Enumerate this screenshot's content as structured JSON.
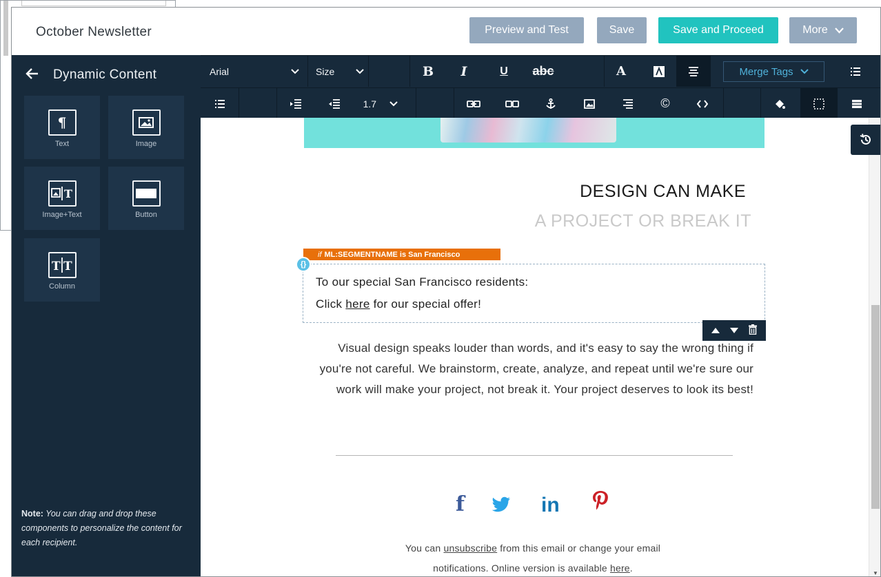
{
  "topbar": {
    "title": "October Newsletter",
    "preview_label": "Preview and Test",
    "save_label": "Save",
    "proceed_label": "Save and Proceed",
    "more_label": "More",
    "accent_color": "#21c3bf",
    "button_color": "#94a8bd"
  },
  "sidebar": {
    "title": "Dynamic Content",
    "back_icon": "arrow-left-icon",
    "tiles": [
      {
        "label": "Text",
        "icon": "pilcrow-icon"
      },
      {
        "label": "Image",
        "icon": "image-icon"
      },
      {
        "label": "Image+Text",
        "icon": "image-text-icon"
      },
      {
        "label": "Button",
        "icon": "button-icon"
      },
      {
        "label": "Column",
        "icon": "column-icon"
      }
    ],
    "note_bold": "Note:",
    "note_text": "You can drag and drop these components to personalize the content for each recipient."
  },
  "toolbar": {
    "font_value": "Arial",
    "size_label": "Size",
    "bold": "B",
    "italic": "I",
    "underline": "U",
    "strike": "abc",
    "text_color": "A",
    "merge_tags_label": "Merge Tags",
    "line_height_value": "1.7"
  },
  "email": {
    "headline_primary": "DESIGN CAN MAKE",
    "headline_secondary": "A PROJECT OR BREAK IT",
    "condition_if": "if",
    "condition_text": "ML:SEGMENTNAME is San Francisco",
    "dynamic_line1": "To our special San Francisco residents:",
    "dynamic_line2_pre": "Click",
    "dynamic_line2_link": "here",
    "dynamic_line2_post": "for our special offer!",
    "body_text": "Visual design speaks louder than words, and it's easy to say the wrong thing if you're not careful. We brainstorm, create, analyze, and repeat until we're sure our work will make your project, not break it. Your project deserves to look its best!",
    "social": [
      {
        "name": "facebook-icon",
        "glyph": "f"
      },
      {
        "name": "twitter-icon",
        "glyph": "🐦"
      },
      {
        "name": "linkedin-icon",
        "glyph": "in"
      },
      {
        "name": "pinterest-icon",
        "glyph": "P"
      }
    ],
    "footer_pre": "You can",
    "footer_link1": "unsubscribe",
    "footer_mid": "from this email or change your email",
    "footer_line2_pre": "notifications. Online version is available",
    "footer_link2": "here",
    "footer_line2_post": "."
  }
}
